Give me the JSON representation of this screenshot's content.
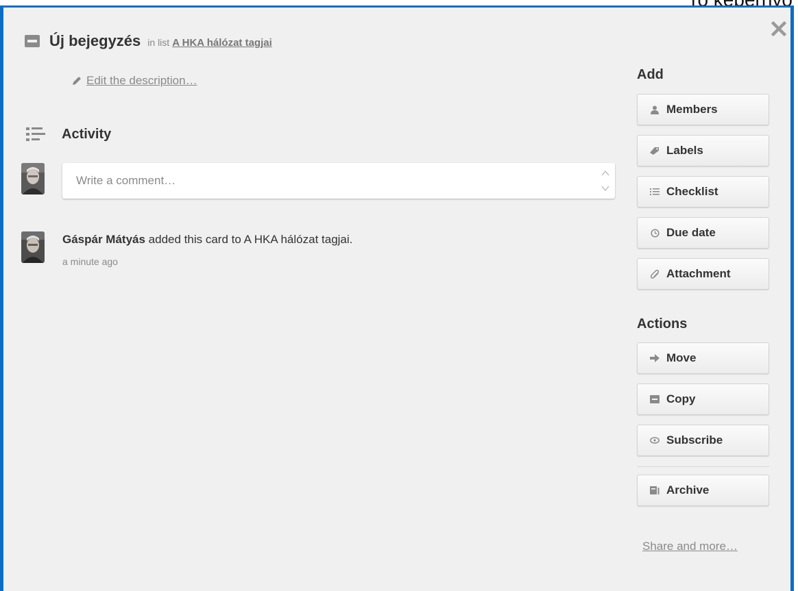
{
  "header_fragment": "ró képernyő",
  "card": {
    "title": "Új bejegyzés",
    "in_list_prefix": "in list",
    "list_name": "A HKA hálózat tagjai"
  },
  "description": {
    "edit_label": "Edit the description…"
  },
  "activity": {
    "heading": "Activity",
    "comment_placeholder": "Write a comment…",
    "entries": [
      {
        "user": "Gáspár Mátyás",
        "action": " added this card to A HKA hálózat tagjai.",
        "time": "a minute ago"
      }
    ]
  },
  "sidebar": {
    "add_heading": "Add",
    "add_buttons": {
      "members": "Members",
      "labels": "Labels",
      "checklist": "Checklist",
      "due_date": "Due date",
      "attachment": "Attachment"
    },
    "actions_heading": "Actions",
    "action_buttons": {
      "move": "Move",
      "copy": "Copy",
      "subscribe": "Subscribe",
      "archive": "Archive"
    },
    "share_link": "Share and more…"
  },
  "close_symbol": "✕"
}
